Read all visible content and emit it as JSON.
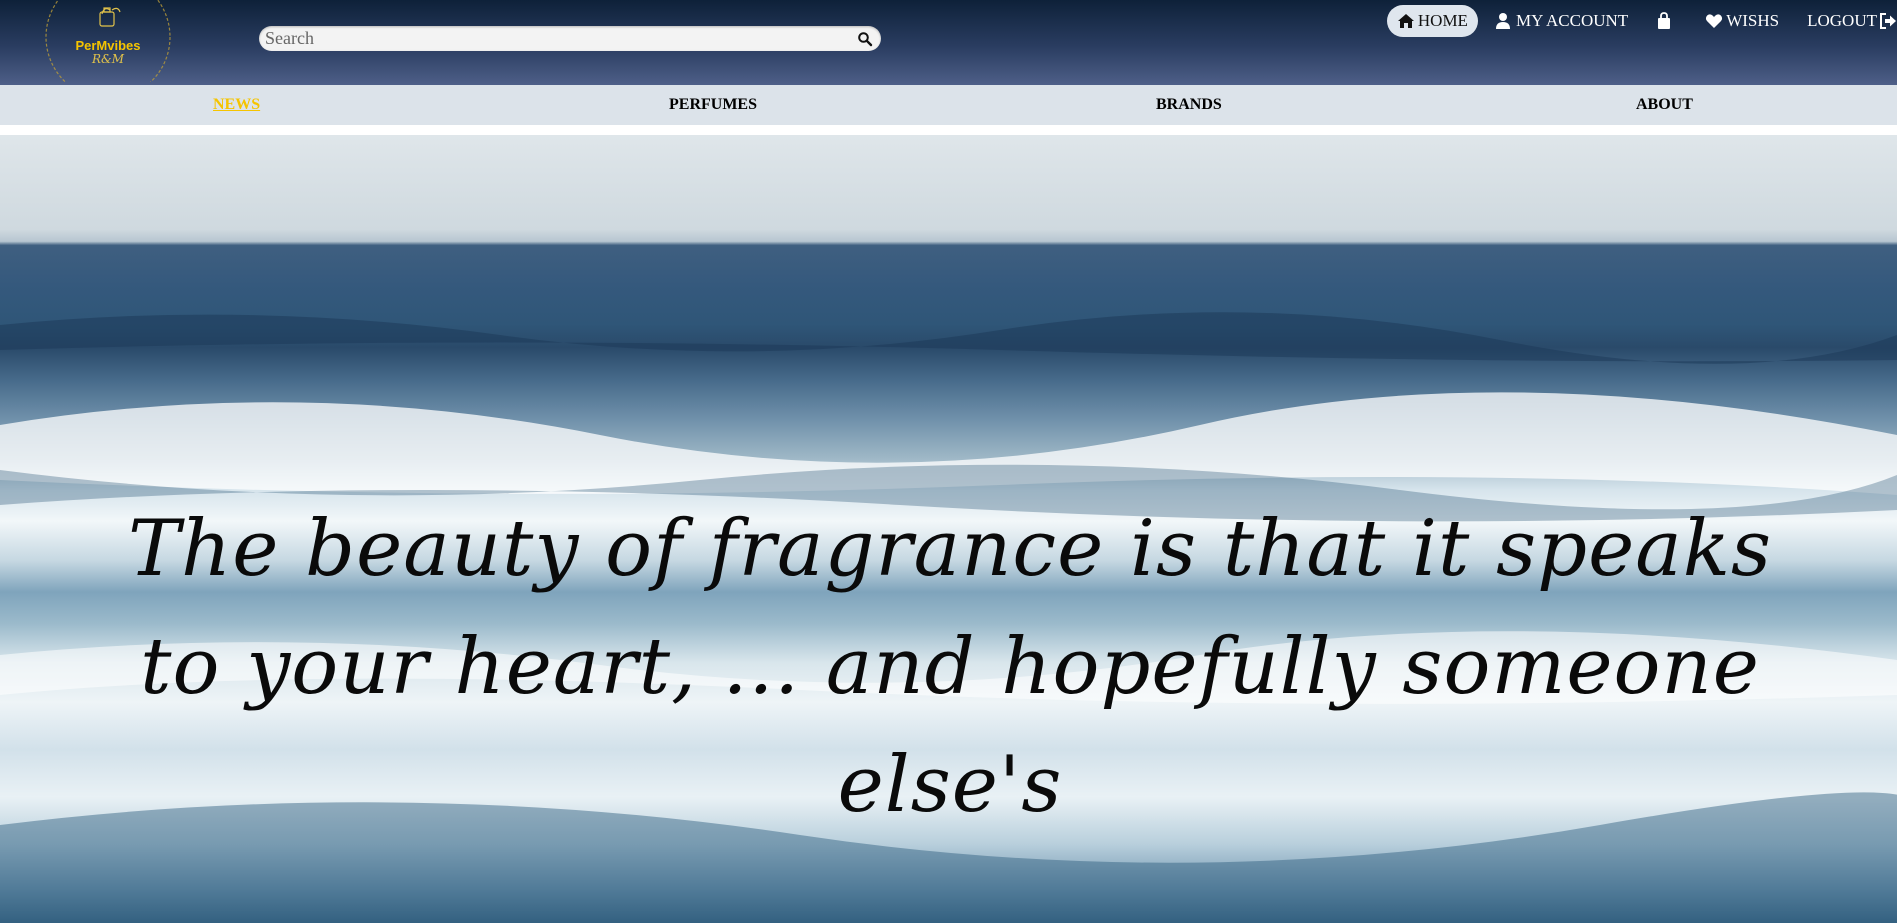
{
  "brand": {
    "logo_name": "PerMvibes",
    "logo_sub": "R&M",
    "accent_color": "#f5c400"
  },
  "search": {
    "placeholder": "Search",
    "icon": "search-icon"
  },
  "top_nav": {
    "home": "HOME",
    "my_account": "MY ACCOUNT",
    "wishes": "WISHS",
    "logout": "LOGOUT"
  },
  "categories": {
    "news": "NEWS",
    "perfumes": "PERFUMES",
    "brands": "BRANDS",
    "about": "ABOUT"
  },
  "hero": {
    "quote": "The beauty of fragrance is that it speaks to your heart, ... and hopefully someone else's"
  }
}
